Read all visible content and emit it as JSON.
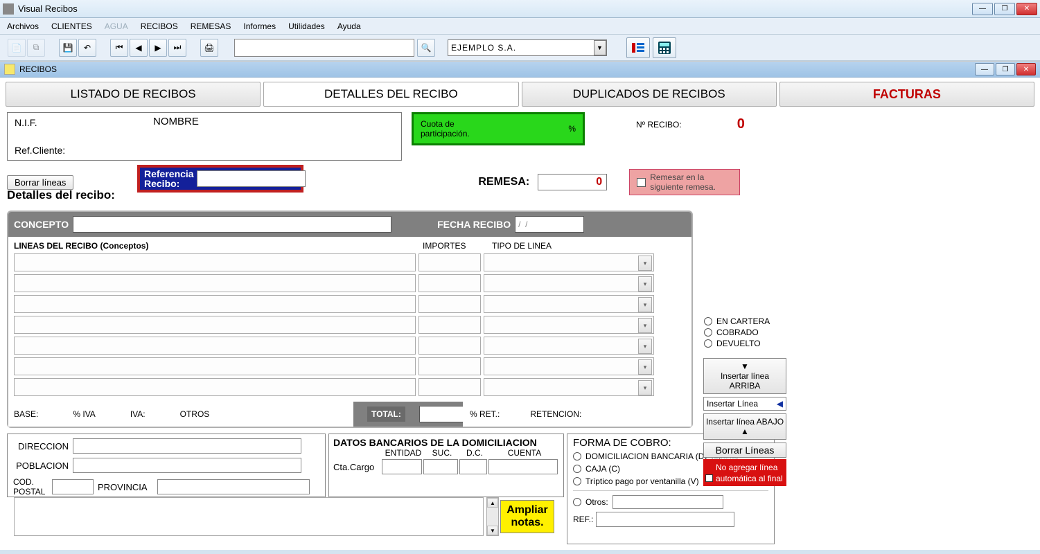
{
  "window": {
    "title": "Visual Recibos"
  },
  "menu": [
    "Archivos",
    "CLIENTES",
    "AGUA",
    "RECIBOS",
    "REMESAS",
    "Informes",
    "Utilidades",
    "Ayuda"
  ],
  "menu_disabled_index": 2,
  "company_selector": "EJEMPLO S.A.",
  "mdi": {
    "title": "RECIBOS"
  },
  "tabs": {
    "listado": "LISTADO DE RECIBOS",
    "detalles": "DETALLES DEL RECIBO",
    "duplicados": "DUPLICADOS DE RECIBOS",
    "facturas": "FACTURAS"
  },
  "header": {
    "nif_label": "N.I.F.",
    "nombre_label": "NOMBRE",
    "refcliente_label": "Ref.Cliente:",
    "cuota_line1": "Cuota de",
    "cuota_line2": "participación.",
    "cuota_pct": "%",
    "nrecibo_label": "Nº RECIBO:",
    "nrecibo_value": "0"
  },
  "row2": {
    "borrar_lineas": "Borrar líneas",
    "referencia_l1": "Referencia",
    "referencia_l2": "Recibo:",
    "detalles_label": "Detalles del recibo:",
    "remesa_label": "REMESA:",
    "remesa_value": "0",
    "remesar_l1": "Remesar en la",
    "remesar_l2": "siguiente remesa."
  },
  "panel": {
    "concepto_label": "CONCEPTO",
    "fecha_label": "FECHA RECIBO",
    "fecha_value": "/  /",
    "col_lineas": "LINEAS DEL RECIBO (Conceptos)",
    "col_importes": "IMPORTES",
    "col_tipo": "TIPO DE LINEA",
    "base": "BASE:",
    "pctiva": "% IVA",
    "iva": "IVA:",
    "otros": "OTROS",
    "total": "TOTAL:",
    "pctret": "% RET.:",
    "retencion": "RETENCION:"
  },
  "rightcol": {
    "en_cartera": "EN CARTERA",
    "cobrado": "COBRADO",
    "devuelto": "DEVUELTO",
    "ins_arriba": "Insertar línea ARRIBA",
    "ins_linea": "Insertar Línea",
    "ins_abajo": "Insertar línea ABAJO",
    "borrar": "Borrar Líneas",
    "no_agg": "No agregar línea automática al final"
  },
  "addr": {
    "direccion": "DIRECCION",
    "poblacion": "POBLACION",
    "codpostal_l1": "COD.",
    "codpostal_l2": "POSTAL",
    "provincia": "PROVINCIA"
  },
  "bank": {
    "title": "DATOS BANCARIOS DE LA DOMICILIACION",
    "entidad": "ENTIDAD",
    "suc": "SUC.",
    "dc": "D.C.",
    "cuenta": "CUENTA",
    "ctacargo": "Cta.Cargo"
  },
  "cobro": {
    "title": "FORMA DE COBRO:",
    "dom": "DOMICILIACION BANCARIA (D)",
    "epana": "(Epaña)",
    "caja": "CAJA (C)",
    "triptico": "Tríptico pago por ventanilla (V)",
    "otros": "Otros:",
    "ref": "REF.:"
  },
  "ampliar": "Ampliar notas."
}
